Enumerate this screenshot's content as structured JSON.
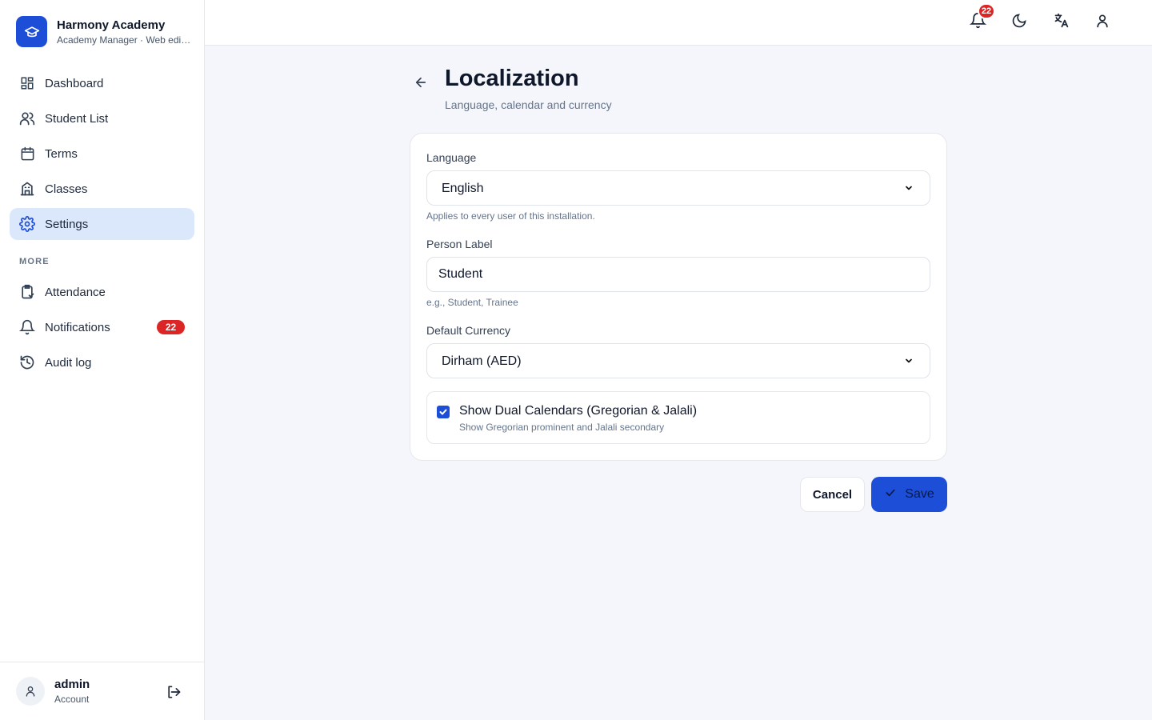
{
  "brand": {
    "title": "Harmony Academy",
    "subtitle": "Academy Manager · Web edition"
  },
  "sidebar": {
    "items": [
      {
        "label": "Dashboard",
        "icon": "dashboard-icon"
      },
      {
        "label": "Student List",
        "icon": "users-icon"
      },
      {
        "label": "Terms",
        "icon": "calendar-icon"
      },
      {
        "label": "Classes",
        "icon": "building-icon"
      },
      {
        "label": "Settings",
        "icon": "gear-icon",
        "active": true
      }
    ],
    "more_label": "MORE",
    "more_items": [
      {
        "label": "Attendance",
        "icon": "clipboard-icon"
      },
      {
        "label": "Notifications",
        "icon": "bell-icon",
        "badge": "22"
      },
      {
        "label": "Audit log",
        "icon": "history-icon"
      }
    ]
  },
  "user": {
    "name": "admin",
    "role": "Account"
  },
  "topbar": {
    "notification_count": "22"
  },
  "page": {
    "title": "Localization",
    "subtitle": "Language, calendar and currency"
  },
  "form": {
    "language": {
      "label": "Language",
      "value": "English",
      "hint": "Applies to every user of this installation."
    },
    "person_label": {
      "label": "Person Label",
      "value": "Student",
      "hint": "e.g., Student, Trainee"
    },
    "currency": {
      "label": "Default Currency",
      "value": "Dirham (AED)"
    },
    "dual_calendar": {
      "label": "Show Dual Calendars (Gregorian & Jalali)",
      "description": "Show Gregorian prominent and Jalali secondary",
      "checked": true
    }
  },
  "actions": {
    "cancel": "Cancel",
    "save": "Save"
  },
  "colors": {
    "accent": "#1d4ed8",
    "active_bg": "#dbe7fb",
    "badge": "#dc2626"
  }
}
